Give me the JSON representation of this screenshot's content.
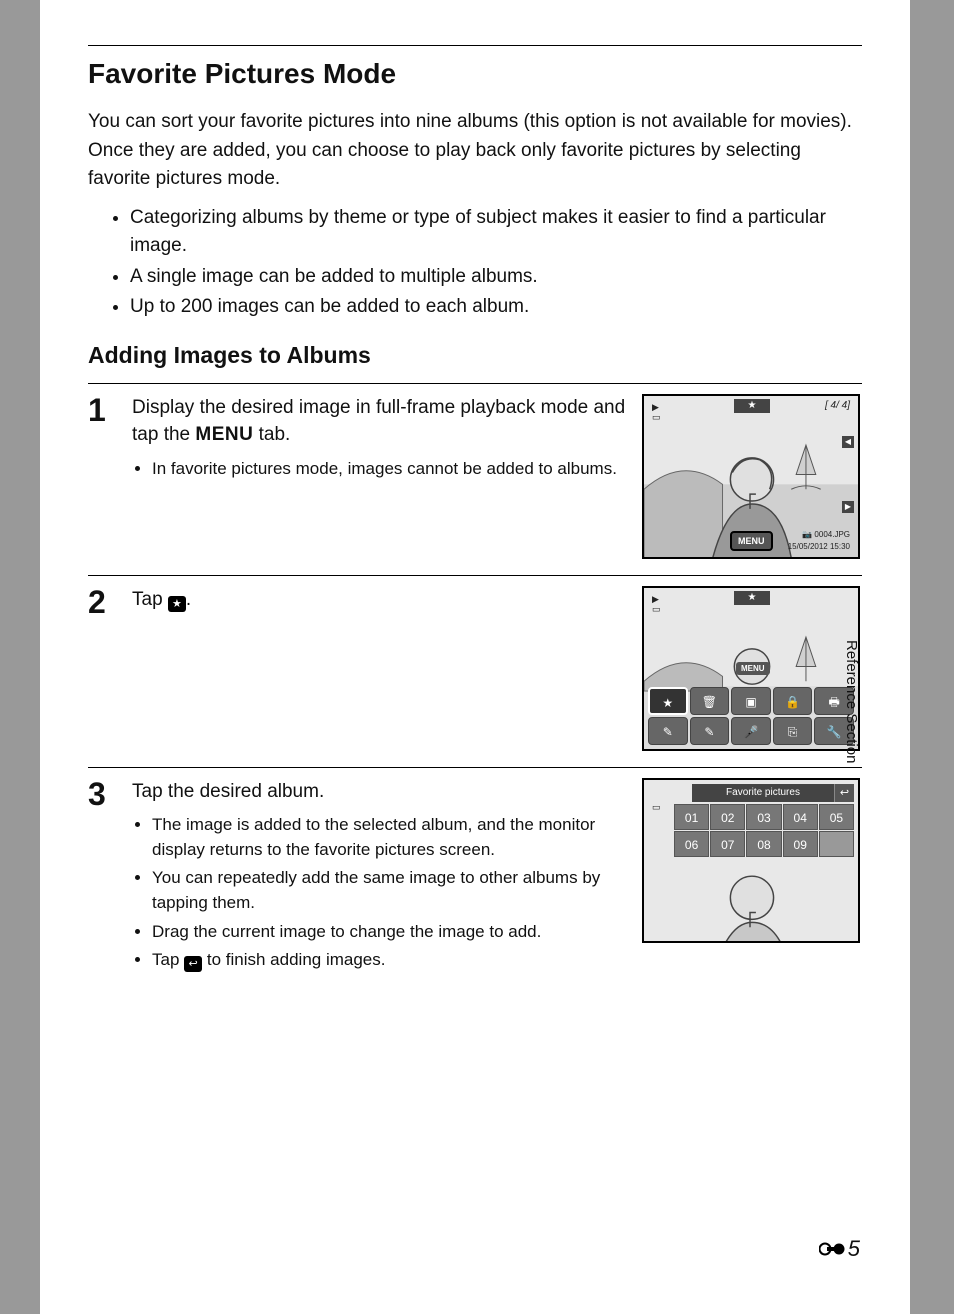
{
  "title": "Favorite Pictures Mode",
  "intro": "You can sort your favorite pictures into nine albums (this option is not available for movies). Once they are added, you can choose to play back only favorite pictures by selecting favorite pictures mode.",
  "top_bullets": [
    "Categorizing albums by theme or type of subject makes it easier to find a particular image.",
    "A single image can be added to multiple albums.",
    "Up to 200 images can be added to each album."
  ],
  "subhead": "Adding Images to Albums",
  "steps": [
    {
      "num": "1",
      "title_before": "Display the desired image in full-frame playback mode and tap the ",
      "menu_word": "MENU",
      "title_after": " tab.",
      "sub": [
        "In favorite pictures mode, images cannot be added to albums."
      ]
    },
    {
      "num": "2",
      "title_before": "Tap ",
      "title_after": "."
    },
    {
      "num": "3",
      "title_before": "Tap the desired album.",
      "sub": [
        "The image is added to the selected album, and the monitor display returns to the favorite pictures screen.",
        "You can repeatedly add the same image to other albums by tapping them.",
        "Drag the current image to change the image to add."
      ],
      "sub_tap_prefix": "Tap ",
      "sub_tap_suffix": " to finish adding images."
    }
  ],
  "screen1": {
    "menu": "MENU",
    "counter": "[    4/    4]",
    "filename": "0004.JPG",
    "datetime": "15/05/2012 15:30"
  },
  "screen2": {
    "menu": "MENU"
  },
  "screen3": {
    "header": "Favorite pictures",
    "albums": [
      "01",
      "02",
      "03",
      "04",
      "05",
      "06",
      "07",
      "08",
      "09"
    ]
  },
  "side_label": "Reference Section",
  "page_number": "5"
}
